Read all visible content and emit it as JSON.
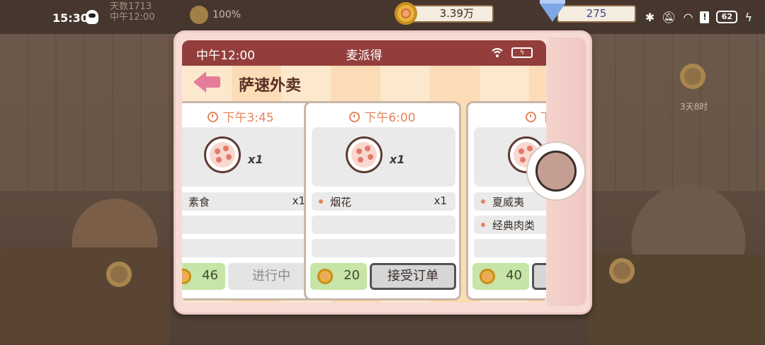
{
  "status_bar": {
    "time": "15:30",
    "battery": "62",
    "hud_ghost_line1": "天数1713",
    "hud_ghost_line2": "中午12:00",
    "hud_ghost_pct": "100%"
  },
  "resources": {
    "coins": "3.39万",
    "gems": "275"
  },
  "app": {
    "time": "中午12:00",
    "name": "麦派得",
    "page_title": "萨速外卖"
  },
  "orders": [
    {
      "time": "下午3:45",
      "qty": "x1",
      "items": [
        {
          "name": "素食",
          "count": "x1"
        }
      ],
      "reward": "46",
      "action": "进行中"
    },
    {
      "time": "下午6:00",
      "qty": "x1",
      "items": [
        {
          "name": "烟花",
          "count": "x1"
        }
      ],
      "reward": "20",
      "action": "接受订单"
    },
    {
      "time": "下午",
      "qty": "",
      "items": [
        {
          "name": "夏威夷",
          "count": ""
        },
        {
          "name": "经典肉类",
          "count": ""
        }
      ],
      "reward": "40",
      "action": ""
    }
  ],
  "background": {
    "timer_text": "3天8时"
  },
  "colors": {
    "app_bar": "#933e3c",
    "accent_orange": "#e5845c",
    "reward_green": "#c6e5a6",
    "back_arrow_pink": "#e37d9a"
  }
}
